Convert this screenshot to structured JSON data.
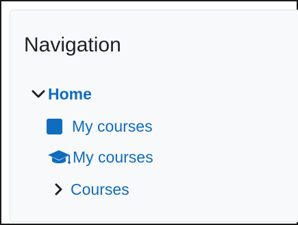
{
  "block": {
    "title": "Navigation"
  },
  "nav": {
    "home": {
      "label": "Home",
      "icon": "chevron-down-icon"
    },
    "items": [
      {
        "label": "My courses",
        "icon": "square-icon",
        "color": "#0f6cbf"
      },
      {
        "label": "My courses",
        "icon": "graduation-cap-icon",
        "color": "#0f6cbf"
      },
      {
        "label": "Courses",
        "icon": "chevron-right-icon",
        "color": "#1d2125"
      }
    ]
  },
  "colors": {
    "link": "#0f6cbf",
    "text": "#1d2125",
    "panel_bg": "#f8f9fa",
    "panel_border": "#dfe1e4"
  }
}
